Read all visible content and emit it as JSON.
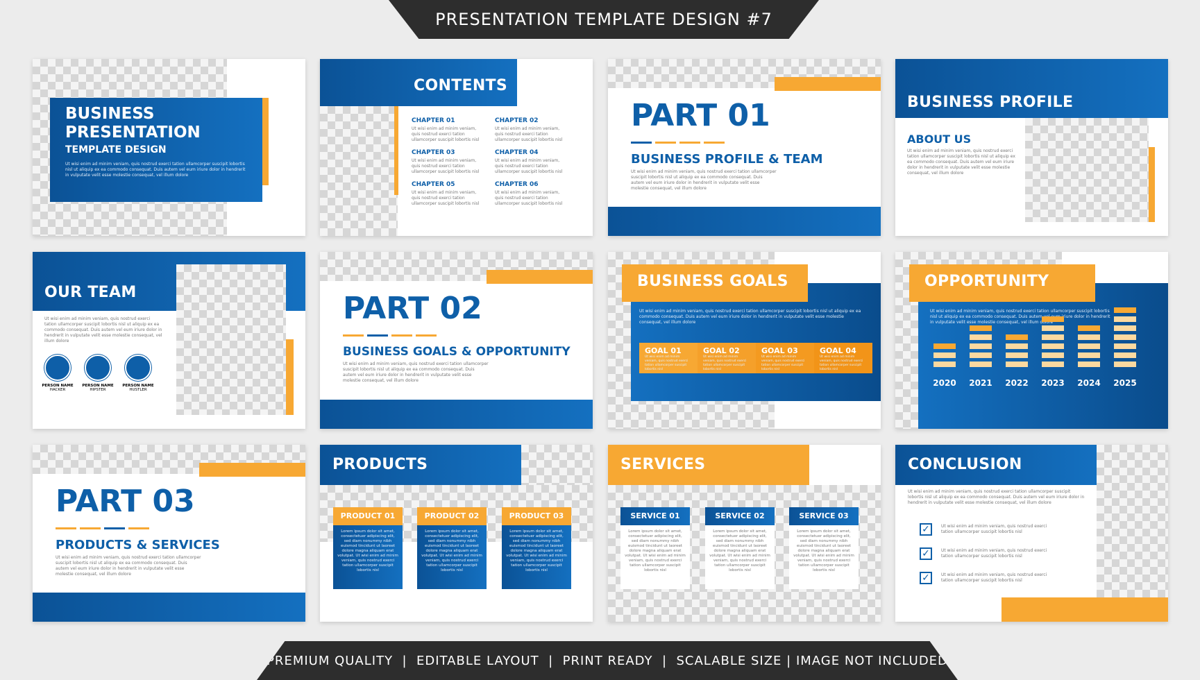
{
  "header": {
    "title": "PRESENTATION TEMPLATE DESIGN #7"
  },
  "footer": {
    "text": "PREMIUM QUALITY  |  EDITABLE LAYOUT  |  PRINT READY  |  SCALABLE SIZE | IMAGE NOT INCLUDED"
  },
  "colors": {
    "blue": "#0e5fa8",
    "orange": "#f7a833",
    "dark": "#2d2d2d"
  },
  "lorem": "Ut wisi enim ad minim veniam, quis nostrud exerci tation ullamcorper suscipit lobortis nisl ut aliquip ex ea commodo consequat. Duis autem vel eum iriure dolor in hendrerit in vulputate velit esse molestie consequat, vel illum dolore",
  "lorem_short": "Ut wisi enim ad minim veniam, quis nostrud exerci tation ullamcorper suscipit lobortis nisl",
  "lorem_card": "Lorem ipsum dolor sit amet, consectetuer adipiscing elit, sed diam nonummy nibh euismod tincidunt ut laoreet dolore magna aliquam erat volutpat. Ut wisi enim ad minim veniam, quis nostrud exerci tation ullamcorper suscipit lobortis nisl",
  "slides": {
    "cover": {
      "line1": "BUSINESS",
      "line2": "PRESENTATION",
      "line3": "TEMPLATE DESIGN"
    },
    "contents": {
      "title": "CONTENTS",
      "chapters": [
        "CHAPTER 01",
        "CHAPTER 02",
        "CHAPTER 03",
        "CHAPTER 04",
        "CHAPTER 05",
        "CHAPTER 06"
      ]
    },
    "part1": {
      "title": "PART 01",
      "subtitle": "BUSINESS PROFILE & TEAM"
    },
    "profile": {
      "title": "BUSINESS PROFILE",
      "subtitle": "ABOUT US"
    },
    "team": {
      "title": "OUR TEAM",
      "members": [
        {
          "name": "PERSON NAME",
          "role": "HACKER"
        },
        {
          "name": "PERSON NAME",
          "role": "HIPSTER"
        },
        {
          "name": "PERSON NAME",
          "role": "HUSTLER"
        }
      ]
    },
    "part2": {
      "title": "PART 02",
      "subtitle": "BUSINESS GOALS & OPPORTUNITY"
    },
    "goals": {
      "title": "BUSINESS GOALS",
      "items": [
        "GOAL 01",
        "GOAL 02",
        "GOAL 03",
        "GOAL 04"
      ]
    },
    "opportunity": {
      "title": "OPPORTUNITY",
      "years": [
        "2020",
        "2021",
        "2022",
        "2023",
        "2024",
        "2025"
      ],
      "levels": [
        3,
        5,
        4,
        6,
        5,
        7
      ]
    },
    "part3": {
      "title": "PART 03",
      "subtitle": "PRODUCTS & SERVICES"
    },
    "products": {
      "title": "PRODUCTS",
      "items": [
        "PRODUCT 01",
        "PRODUCT 02",
        "PRODUCT 03"
      ]
    },
    "services": {
      "title": "SERVICES",
      "items": [
        "SERVICE 01",
        "SERVICE 02",
        "SERVICE 03"
      ]
    },
    "conclusion": {
      "title": "CONCLUSION"
    }
  }
}
